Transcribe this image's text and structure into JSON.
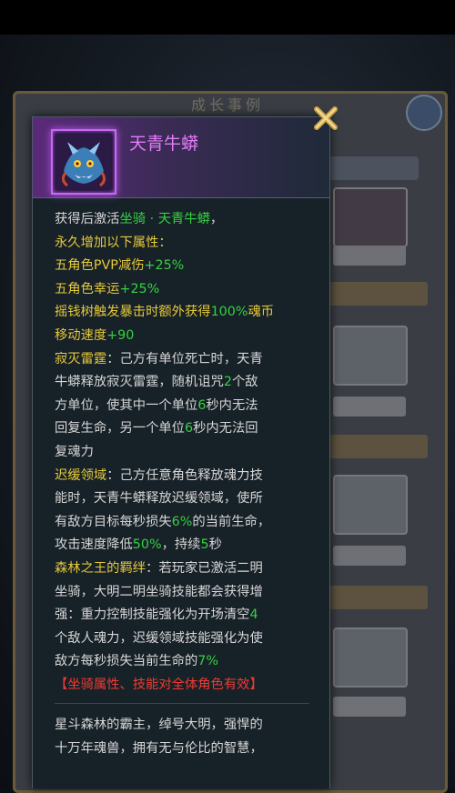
{
  "item": {
    "name": "天青牛蟒"
  },
  "description": {
    "line1_a": "获得后激活",
    "line1_b": "坐骑 · 天青牛蟒",
    "line1_c": "，",
    "line2": "永久增加以下属性：",
    "line3_a": "五角色PVP减伤",
    "line3_b": "+25%",
    "line4_a": "五角色幸运",
    "line4_b": "+25%",
    "line5_a": "摇钱树触发暴击时额外获得",
    "line5_b": "100%",
    "line5_c": "魂币",
    "line6_a": "移动速度",
    "line6_b": "+90",
    "skill1_name": "寂灭雷霆",
    "skill1_l1": "：己方有单位死亡时，天青",
    "skill1_l2_a": "牛蟒释放寂灭雷霆，随机诅咒",
    "skill1_l2_b": "2",
    "skill1_l2_c": "个敌",
    "skill1_l3_a": "方单位，使其中一个单位",
    "skill1_l3_b": "6",
    "skill1_l3_c": "秒内无法",
    "skill1_l4_a": "回复生命，另一个单位",
    "skill1_l4_b": "6",
    "skill1_l4_c": "秒内无法回",
    "skill1_l5": "复魂力",
    "skill2_name": "迟缓领域",
    "skill2_l1": "：己方任意角色释放魂力技",
    "skill2_l2": "能时，天青牛蟒释放迟缓领域，使所",
    "skill2_l3_a": "有敌方目标每秒损失",
    "skill2_l3_b": "6%",
    "skill2_l3_c": "的当前生命，",
    "skill2_l4_a": "攻击速度降低",
    "skill2_l4_b": "50%",
    "skill2_l4_c": "，持续",
    "skill2_l4_d": "5",
    "skill2_l4_e": "秒",
    "skill3_name": "森林之王的羁绊",
    "skill3_l1": "：若玩家已激活二明",
    "skill3_l2": "坐骑，大明二明坐骑技能都会获得增",
    "skill3_l3_a": "强：重力控制技能强化为开场清空",
    "skill3_l3_b": "4",
    "skill3_l4": "个敌人魂力，迟缓领域技能强化为使",
    "skill3_l5_a": "敌方每秒损失当前生命的",
    "skill3_l5_b": "7%",
    "note": "【坐骑属性、技能对全体角色有效】",
    "lore_l1": "星斗森林的霸主，绰号大明，强悍的",
    "lore_l2": "十万年魂兽，拥有无与伦比的智慧，"
  },
  "background": {
    "title": "成长事例"
  },
  "colors": {
    "title_purple": "#e37cf7",
    "highlight_green": "#35d142",
    "skill_yellow": "#e5c93a",
    "note_red": "#ef3b33"
  },
  "icons": {
    "close": "close-x-icon",
    "item": "blue-dragon-mount-icon"
  }
}
